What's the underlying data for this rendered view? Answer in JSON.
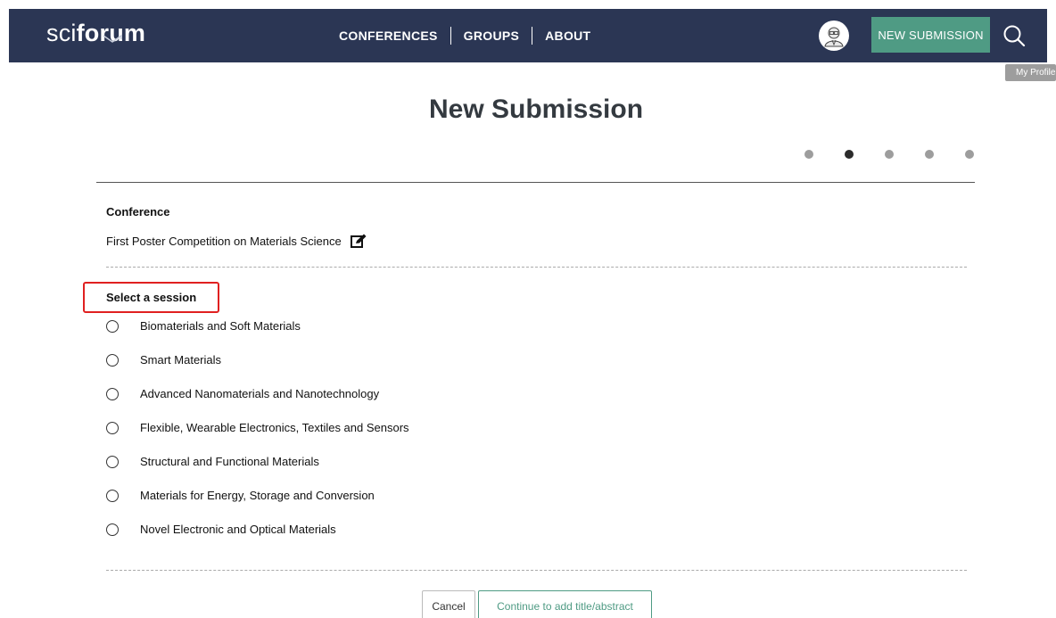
{
  "header": {
    "logo_thin": "sci",
    "logo_bold": "forum",
    "nav": [
      "CONFERENCES",
      "GROUPS",
      "ABOUT"
    ],
    "new_submission_label": "NEW SUBMISSION",
    "tooltip": "My Profile"
  },
  "page": {
    "title": "New Submission",
    "steps_total": 5,
    "active_step": 2
  },
  "conference": {
    "label": "Conference",
    "value": "First Poster Competition on Materials Science"
  },
  "session": {
    "label": "Select a session",
    "options": [
      "Biomaterials and Soft Materials",
      "Smart Materials",
      "Advanced Nanomaterials and Nanotechnology",
      "Flexible, Wearable Electronics, Textiles and Sensors",
      "Structural and Functional Materials",
      "Materials for Energy, Storage and Conversion",
      "Novel Electronic and Optical Materials"
    ]
  },
  "actions": {
    "cancel": "Cancel",
    "continue": "Continue to add title/abstract"
  },
  "colors": {
    "navbar": "#2b3654",
    "accent": "#4f9b84",
    "highlight": "#e02020"
  }
}
